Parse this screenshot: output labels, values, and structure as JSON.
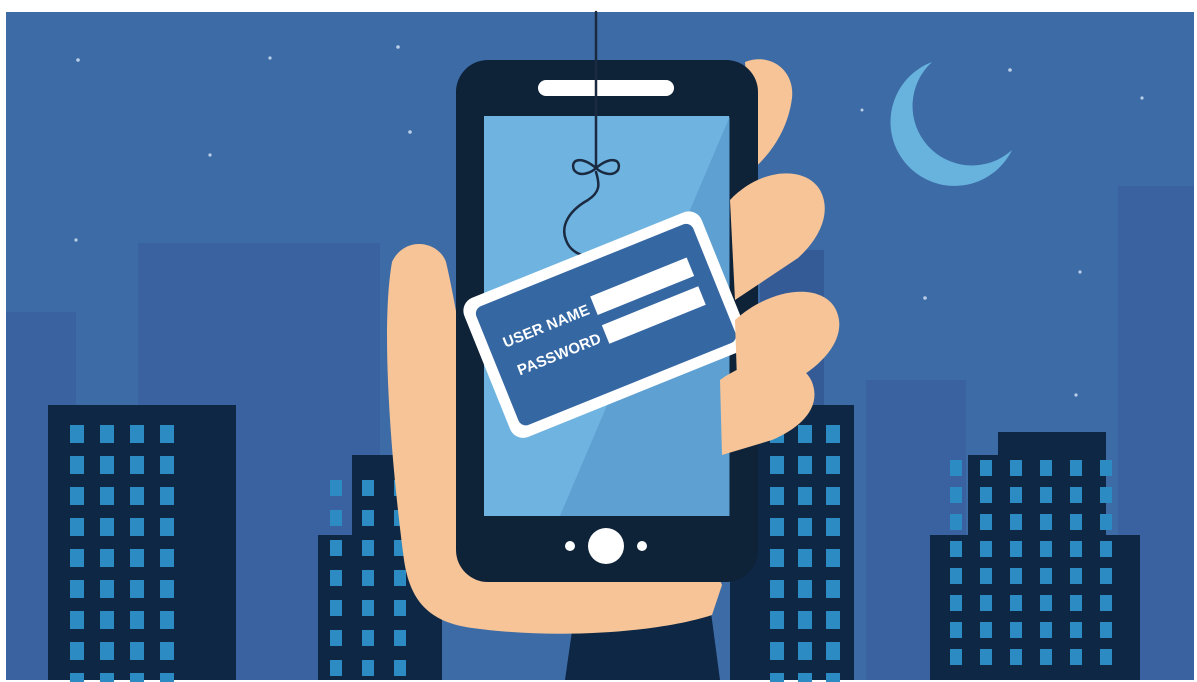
{
  "scene": {
    "login_card": {
      "username_label": "USER NAME",
      "password_label": "PASSWORD"
    }
  },
  "colors": {
    "sky": "#3d6ba6",
    "building_back": "#3a62a0",
    "building_mid": "#345b96",
    "building_front": "#0d2744",
    "window": "#2d8bc4",
    "moon": "#68b3de",
    "phone_body": "#0e2238",
    "phone_screen": "#6fb3e0",
    "skin": "#f6c497",
    "card_border": "#ffffff",
    "card_fill": "#3567a3"
  },
  "icons": [
    "moon-icon",
    "fishing-hook-icon",
    "phone-home-button-icon"
  ]
}
